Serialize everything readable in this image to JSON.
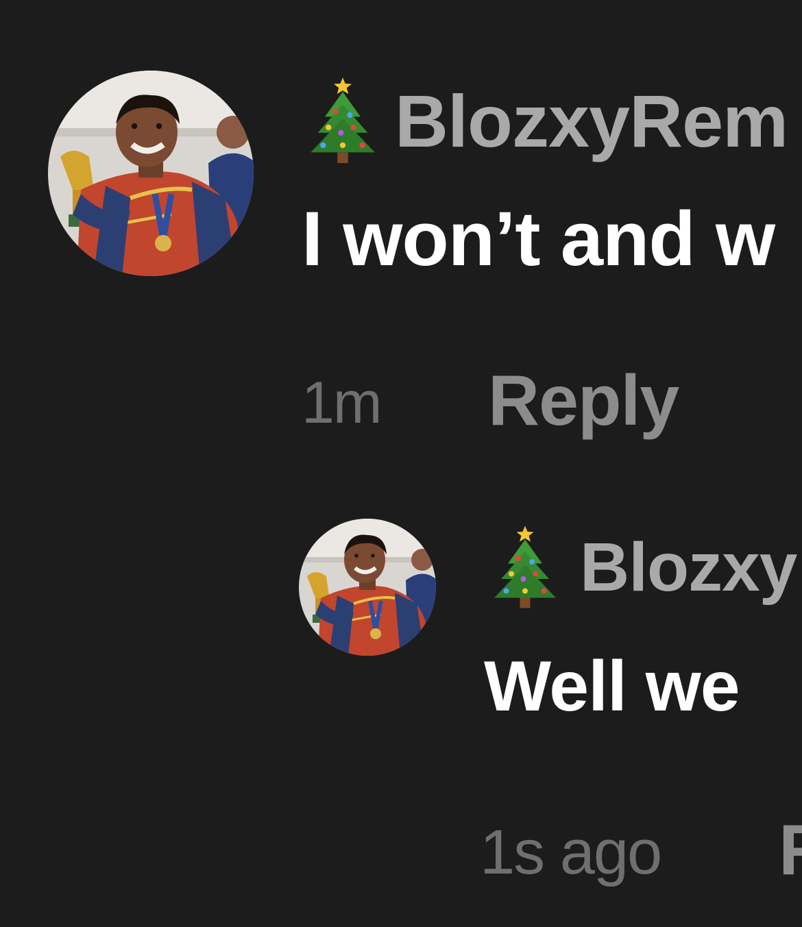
{
  "comments": [
    {
      "username": "BlozxyRem",
      "username_emoji": "christmas-tree",
      "text": "I won’t and w",
      "time": "1m",
      "reply_label": "Reply",
      "avatar": "user-avatar-photo"
    },
    {
      "username": "Blozxy",
      "username_emoji": "christmas-tree",
      "text": "Well we",
      "time": "1s ago",
      "reply_label": "R",
      "avatar": "user-avatar-photo"
    }
  ],
  "theme": {
    "background": "#1c1c1c",
    "username_color": "#a9a9a9",
    "text_color": "#ffffff",
    "time_color": "#6f6f6f",
    "reply_color": "#8c8c8c"
  }
}
